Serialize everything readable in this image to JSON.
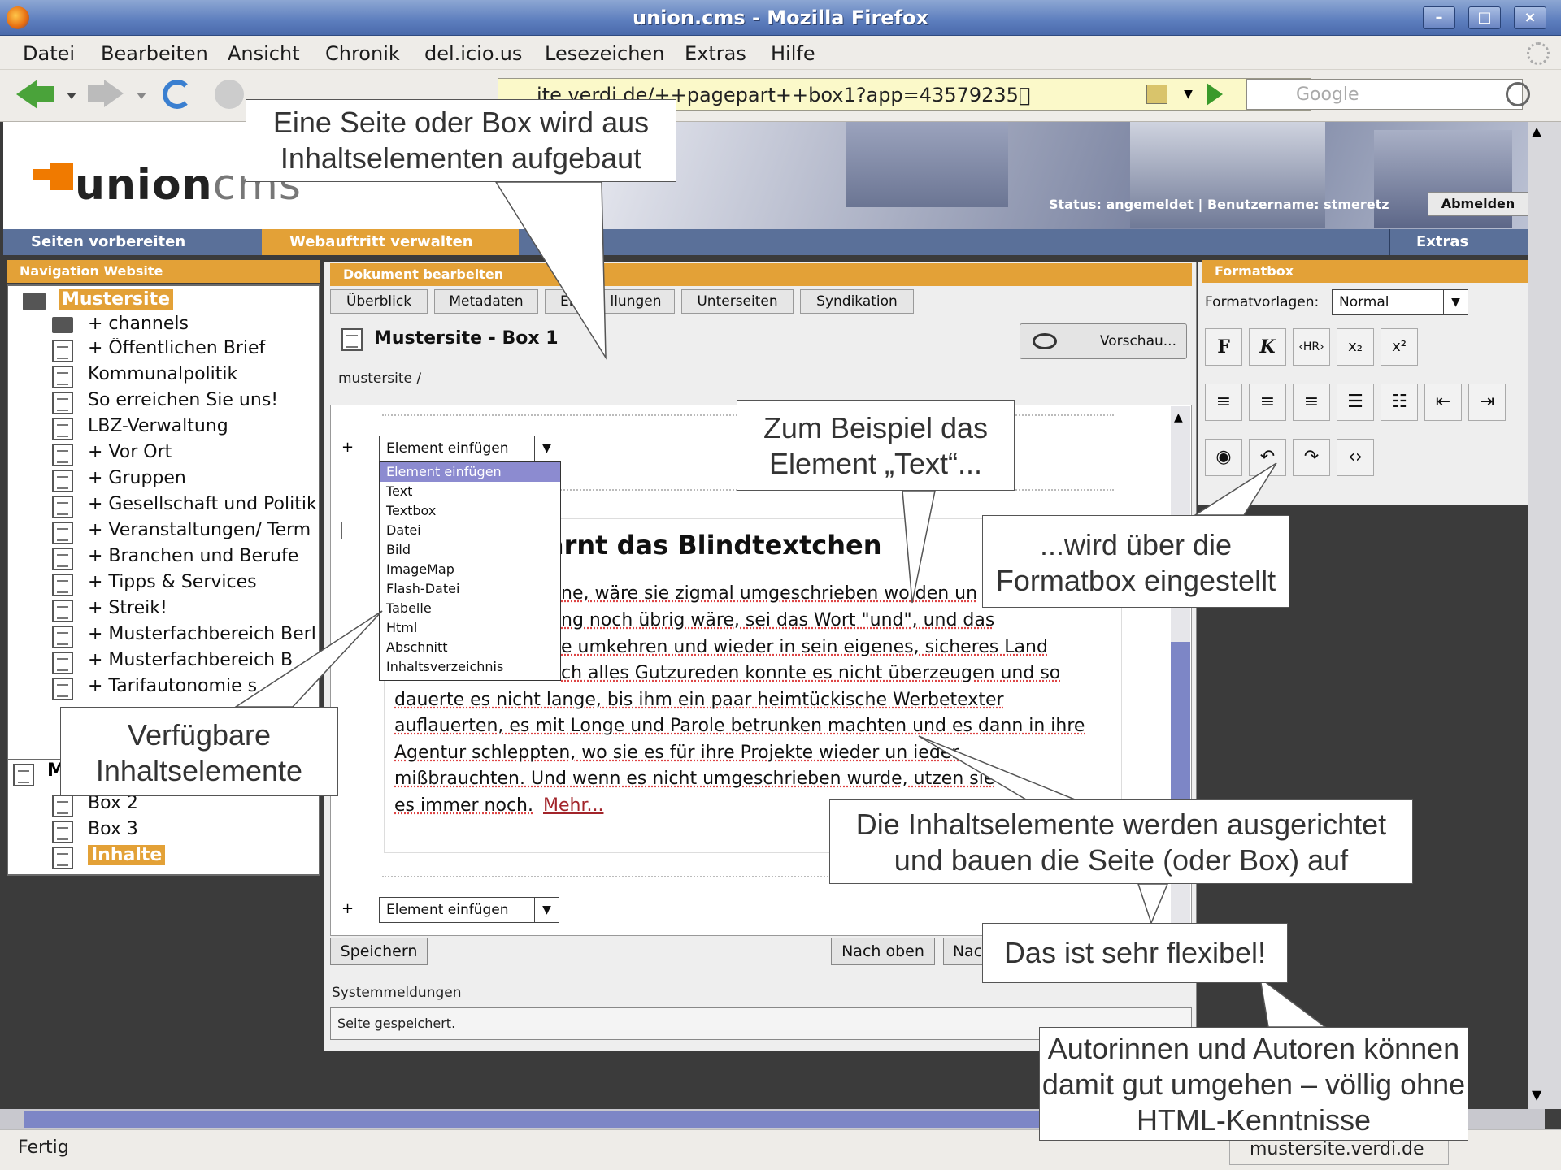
{
  "window": {
    "title": "union.cms - Mozilla Firefox",
    "btn_min": "–",
    "btn_max": "□",
    "btn_close": "×"
  },
  "menu": [
    "Datei",
    "Bearbeiten",
    "Ansicht",
    "Chronik",
    "del.icio.us",
    "Lesezeichen",
    "Extras",
    "Hilfe"
  ],
  "toolbar": {
    "url": "http://mustersite.verdi.de/++pagepart++box1?app=43579235",
    "url_visible": "ite.verdi.de/++pagepart++box1?app=43579235\u0000",
    "search_placeholder": "Google"
  },
  "header": {
    "logo_main": "union",
    "logo_sub": "cms",
    "status": "Status: angemeldet | Benutzername: stmeretz",
    "logout": "Abmelden"
  },
  "tabs": {
    "t1": "Seiten vorbereiten",
    "t2": "Webauftritt verwalten",
    "t3": "Extras"
  },
  "nav": {
    "header": "Navigation Website",
    "root": "Mustersite",
    "items": [
      "+ channels",
      "+ Öffentlichen Brief",
      "Kommunalpolitik",
      "So erreichen Sie uns!",
      "LBZ-Verwaltung",
      "+ Vor Ort",
      "+ Gruppen",
      "+ Gesellschaft und Politik",
      "+ Veranstaltungen/ Term",
      "+ Branchen und Berufe",
      "+ Tipps & Services",
      "+ Streik!",
      "+ Musterfachbereich Berl",
      "+ Musterfachbereich B",
      "+ Tarifautonomie s"
    ],
    "section2_letter": "M",
    "items2": [
      "Box 2",
      "Box 3",
      "Inhalte"
    ]
  },
  "main": {
    "header": "Dokument bearbeiten",
    "subtabs": [
      "Überblick",
      "Metadaten",
      "Ei",
      "llungen",
      "Unterseiten",
      "Syndikation"
    ],
    "doc_title": "Mustersite - Box 1",
    "preview": "Vorschau...",
    "breadcrumb": "mustersite /",
    "insert_label": "Element einfügen",
    "plus": "+",
    "dropdown": [
      "Element einfügen",
      "Text",
      "Textbox",
      "Datei",
      "Bild",
      "ImageMap",
      "Flash-Datei",
      "Tabelle",
      "Html",
      "Abschnitt",
      "Inhaltsverzeichnis"
    ],
    "heading_fragment": "arnt das Blindtextchen",
    "text_lines": [
      "ne, wäre sie zigmal umgeschrieben wo den un",
      "ng noch übrig wäre, sei das Wort \"und\", und das",
      "e umkehren und wieder in sein eigenes, sicheres Land",
      "ch alles Gutzureden konnte es nicht überzeugen und so",
      "dauerte es nicht lange, bis ihm ein paar heimtückische Werbetexter",
      "auflauerten, es mit Longe und Parole betrunken machten und es dann in ihre",
      "Agentur schleppten, wo sie es für ihre Projekte wieder un ieder",
      "mißbrauchten. Und wenn es nicht umgeschrieben wurde, utzen sie",
      "es immer noch."
    ],
    "more": "Mehr...",
    "save": "Speichern",
    "up": "Nach oben",
    "down": "Nac",
    "sys_label": "Systemmeldungen",
    "sys_msg": "Seite gespeichert."
  },
  "formatbox": {
    "header": "Formatbox",
    "label": "Formatvorlagen:",
    "value": "Normal",
    "row1": [
      "F",
      "K",
      "‹HR›",
      "x₂",
      "x²"
    ],
    "row2": [
      "≡",
      "≡",
      "≡",
      "☰",
      "☷",
      "⇤",
      "⇥"
    ],
    "row3": [
      "◉",
      "↶",
      "↷",
      "‹›"
    ]
  },
  "callouts": {
    "c1": "Eine Seite oder Box wird aus Inhaltselementen aufgebaut",
    "c2": "Zum Beispiel das Element „Text“...",
    "c3": "...wird über die Formatbox eingestellt",
    "c4": "Verfügbare Inhaltselemente",
    "c5": "Die Inhaltselemente werden ausgerichtet und bauen die Seite (oder Box) auf",
    "c6": "Das ist sehr flexibel!",
    "c7": "Autorinnen und Autoren können damit gut umgehen – völlig ohne HTML-Kenntnisse"
  },
  "statusbar": {
    "left": "Fertig",
    "right": "mustersite.verdi.de"
  }
}
